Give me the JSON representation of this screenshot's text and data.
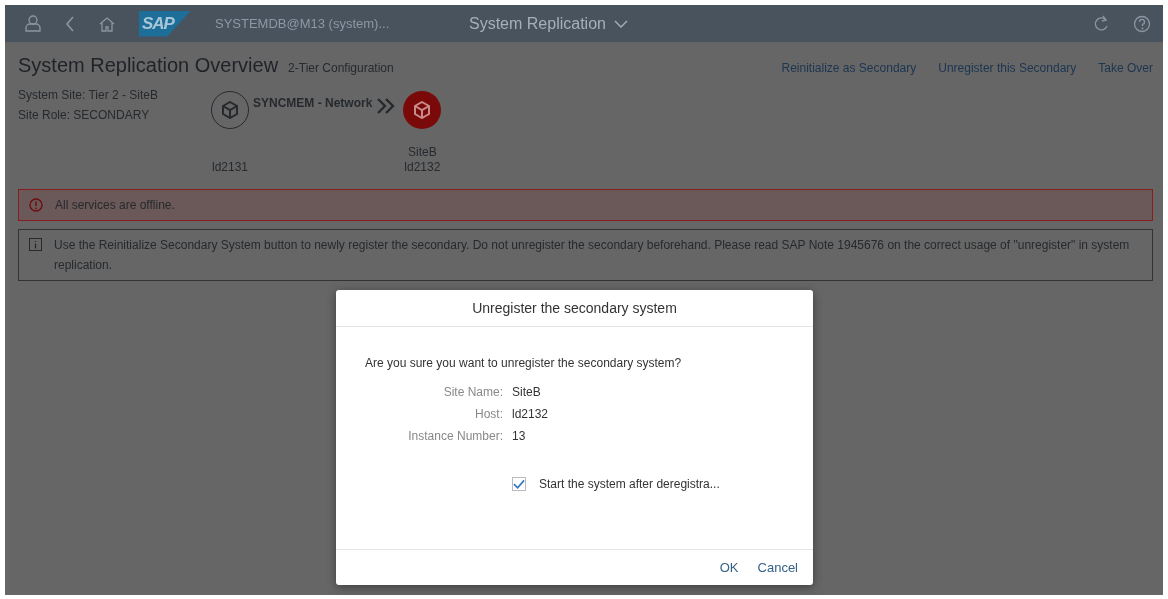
{
  "shell_bar": {
    "logo": "SAP",
    "system": "SYSTEMDB@M13 (system)...",
    "app_title": "System Replication"
  },
  "header": {
    "title": "System Replication Overview",
    "subtitle": "2-Tier Configuration",
    "actions": [
      "Reinitialize as Secondary",
      "Unregister this Secondary",
      "Take Over"
    ]
  },
  "site_info": [
    "System Site: Tier 2 - SiteB",
    "Site Role: SECONDARY"
  ],
  "topology": {
    "connection": "SYNCMEM - Network",
    "nodes": [
      {
        "kind": "outline",
        "labels": [
          "ld2131"
        ]
      },
      {
        "kind": "filled",
        "color": "#7a0a0a",
        "labels": [
          "SiteB",
          "ld2132"
        ]
      }
    ]
  },
  "messages": [
    {
      "kind": "error",
      "text": "All services are offline."
    },
    {
      "kind": "info",
      "text": "Use the Reinitialize Secondary System button to newly register the secondary. Do not unregister the secondary beforehand. Please read SAP Note 1945676 on the correct usage of \"unregister\" in system replication."
    }
  ],
  "dialog": {
    "title": "Unregister the secondary system",
    "question": "Are you sure you want to unregister the secondary system?",
    "fields": [
      {
        "label": "Site Name:",
        "value": "SiteB"
      },
      {
        "label": "Host:",
        "value": "ld2132"
      },
      {
        "label": "Instance Number:",
        "value": "13"
      }
    ],
    "checkbox": {
      "label": "Start the system after deregistra...",
      "checked": true
    },
    "buttons": [
      "OK",
      "Cancel"
    ]
  }
}
